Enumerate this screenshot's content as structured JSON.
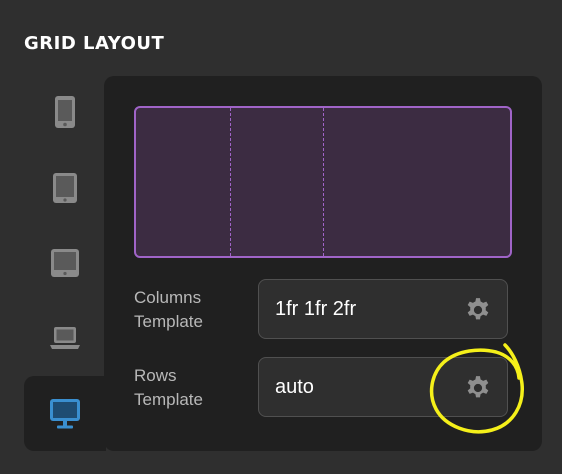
{
  "header": {
    "title": "GRID LAYOUT"
  },
  "devices": [
    {
      "icon": "mobile-icon",
      "active": false
    },
    {
      "icon": "tablet-portrait-icon",
      "active": false
    },
    {
      "icon": "tablet-landscape-icon",
      "active": false
    },
    {
      "icon": "laptop-icon",
      "active": false
    },
    {
      "icon": "desktop-icon",
      "active": true
    }
  ],
  "colors": {
    "accent": "#a064c8",
    "grid_fill": "#3c2c42",
    "active_device": "#3a8fd0",
    "annotation": "#f5f01a"
  },
  "columns": {
    "label_line1": "Columns",
    "label_line2": "Template",
    "value": "1fr 1fr 2fr",
    "fractions": [
      1,
      1,
      2
    ]
  },
  "rows": {
    "label_line1": "Rows",
    "label_line2": "Template",
    "value": "auto"
  }
}
